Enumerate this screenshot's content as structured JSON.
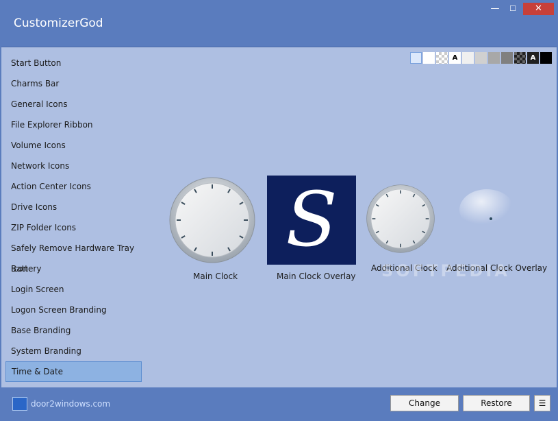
{
  "window": {
    "title": "CustomizerGod",
    "minimize_glyph": "—",
    "maximize_glyph": "☐",
    "close_glyph": "✕"
  },
  "sidebar": {
    "items": [
      {
        "label": "Start Button"
      },
      {
        "label": "Charms Bar"
      },
      {
        "label": "General Icons"
      },
      {
        "label": "File Explorer Ribbon"
      },
      {
        "label": "Volume Icons"
      },
      {
        "label": "Network Icons"
      },
      {
        "label": "Action Center Icons"
      },
      {
        "label": "Drive Icons"
      },
      {
        "label": "ZIP Folder Icons"
      },
      {
        "label": "Safely Remove Hardware Tray Icon"
      },
      {
        "label": "Battery"
      },
      {
        "label": "Login Screen"
      },
      {
        "label": "Logon Screen Branding"
      },
      {
        "label": "Base Branding"
      },
      {
        "label": "System Branding"
      },
      {
        "label": "Time & Date"
      }
    ],
    "selected": "Time & Date"
  },
  "swatches": {
    "items": [
      {
        "color": "#dce8fb",
        "text": ""
      },
      {
        "color": "#ffffff",
        "text": ""
      },
      {
        "color": "#eeeeee",
        "text": ""
      },
      {
        "color": "#ffffff",
        "text": "A"
      },
      {
        "color": "#f0f0f0",
        "text": ""
      },
      {
        "color": "#d0d0d0",
        "text": ""
      },
      {
        "color": "#a8a8a8",
        "text": ""
      },
      {
        "color": "#808080",
        "text": ""
      },
      {
        "color": "#404040",
        "text": ""
      },
      {
        "color": "#202020",
        "text": "A"
      },
      {
        "color": "#000000",
        "text": ""
      }
    ]
  },
  "resources": {
    "main_clock": "Main Clock",
    "main_clock_overlay": "Main Clock Overlay",
    "overlay_letter": "S",
    "additional_clock": "Additional Clock",
    "additional_clock_overlay": "Additional Clock Overlay"
  },
  "watermark": "SOFTPEDIA",
  "footer": {
    "logo_text": "door2windows.com",
    "change_label": "Change",
    "restore_label": "Restore",
    "menu_glyph": "☰"
  },
  "colors": {
    "accent": "#5a7cbe",
    "content_bg": "#aebfe2",
    "selected_bg": "#8db2e2",
    "overlay_bg": "#0d1f5c"
  }
}
